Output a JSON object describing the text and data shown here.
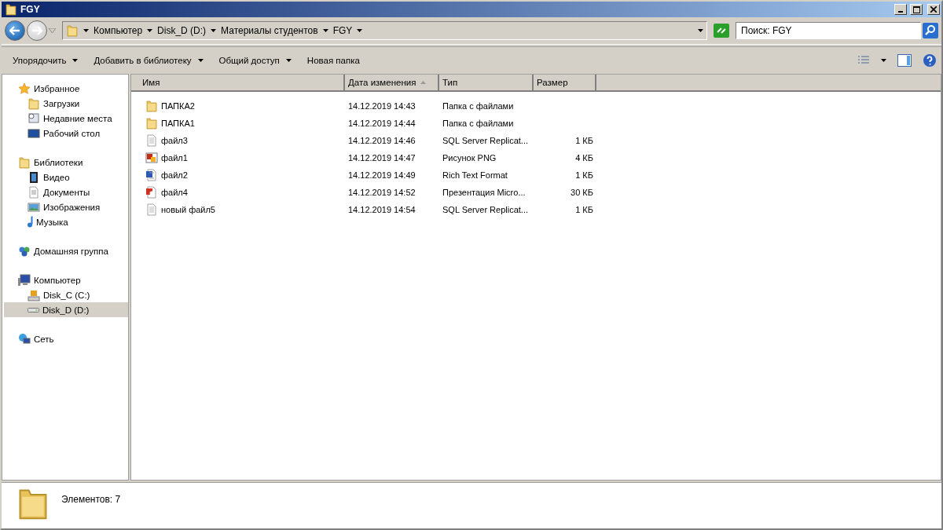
{
  "window": {
    "title": "FGY"
  },
  "address": {
    "crumbs": [
      "Компьютер",
      "Disk_D (D:)",
      "Материалы студентов",
      "FGY"
    ]
  },
  "search": {
    "placeholder": "Поиск: FGY"
  },
  "toolbar": [
    {
      "label": "Упорядочить",
      "dropdown": true
    },
    {
      "label": "Добавить в библиотеку",
      "dropdown": true
    },
    {
      "label": "Общий доступ",
      "dropdown": true
    },
    {
      "label": "Новая папка",
      "dropdown": false
    }
  ],
  "sidebar": {
    "groups": [
      {
        "label": "Избранное",
        "selected": false,
        "children": [
          {
            "label": "Загрузки",
            "selected": false
          },
          {
            "label": "Недавние места",
            "selected": false
          },
          {
            "label": "Рабочий стол",
            "selected": false
          }
        ]
      },
      {
        "label": "Библиотеки",
        "selected": false,
        "children": [
          {
            "label": "Видео",
            "selected": false
          },
          {
            "label": "Документы",
            "selected": false
          },
          {
            "label": "Изображения",
            "selected": false
          },
          {
            "label": "Музыка",
            "selected": false
          }
        ]
      },
      {
        "label": "Домашняя группа",
        "selected": false
      },
      {
        "label": "Компьютер",
        "selected": false,
        "children": [
          {
            "label": "Disk_C (C:)",
            "selected": false
          },
          {
            "label": "Disk_D (D:)",
            "selected": true
          }
        ]
      },
      {
        "label": "Сеть",
        "selected": false
      }
    ]
  },
  "table": {
    "columns": [
      {
        "label": "Имя",
        "sorted": false
      },
      {
        "label": "Дата изменения",
        "sorted": true
      },
      {
        "label": "Тип",
        "sorted": false
      },
      {
        "label": "Размер",
        "sorted": false
      }
    ],
    "rows": [
      {
        "kind": "folder",
        "name": "ПАПКА2",
        "date": "14.12.2019 14:43",
        "type": "Папка с файлами",
        "size": ""
      },
      {
        "kind": "folder",
        "name": "ПАПКА1",
        "date": "14.12.2019 14:44",
        "type": "Папка с файлами",
        "size": ""
      },
      {
        "kind": "text",
        "name": "файл3",
        "date": "14.12.2019 14:46",
        "type": "SQL Server Replicat...",
        "size": "1 КБ"
      },
      {
        "kind": "image",
        "name": "файл1",
        "date": "14.12.2019 14:47",
        "type": "Рисунок PNG",
        "size": "4 КБ"
      },
      {
        "kind": "word",
        "name": "файл2",
        "date": "14.12.2019 14:49",
        "type": "Rich Text Format",
        "size": "1 КБ"
      },
      {
        "kind": "slides",
        "name": "файл4",
        "date": "14.12.2019 14:52",
        "type": "Презентация Micro...",
        "size": "30 КБ"
      },
      {
        "kind": "text",
        "name": "новый файл5",
        "date": "14.12.2019 14:54",
        "type": "SQL Server Replicat...",
        "size": "1 КБ"
      }
    ]
  },
  "status_bar": {
    "text": "Элементов: 7"
  }
}
